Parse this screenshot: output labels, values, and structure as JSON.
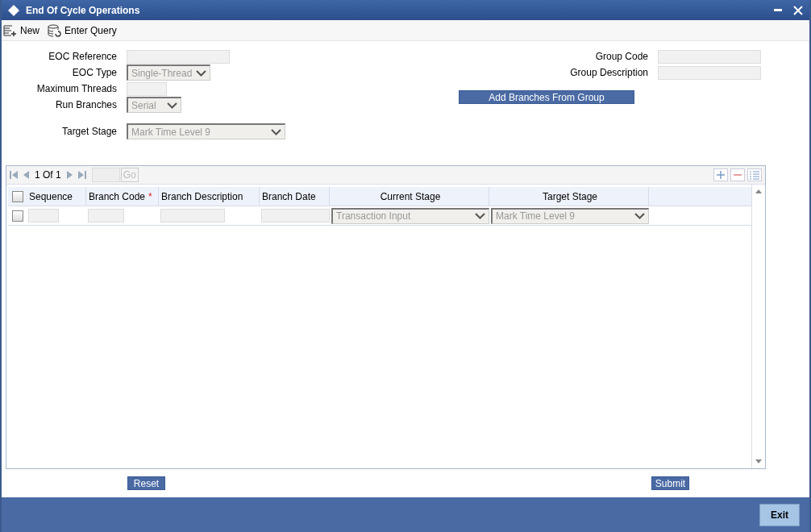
{
  "window": {
    "title": "End Of Cycle Operations"
  },
  "toolbar": [
    {
      "kind": "new",
      "label": "New"
    },
    {
      "kind": "query",
      "label": "Enter Query"
    }
  ],
  "form": {
    "left": [
      {
        "label": "EOC Reference",
        "kind": "text",
        "disabled": true
      },
      {
        "label": "EOC Type",
        "kind": "select",
        "value": "Single-Thread",
        "disabled": true
      },
      {
        "label": "Maximum Threads",
        "kind": "text",
        "disabled": true
      },
      {
        "label": "Run Branches",
        "kind": "select",
        "value": "Serial",
        "disabled": true
      },
      {
        "label": "Target Stage",
        "kind": "select",
        "value": "Mark Time Level 9",
        "disabled": true
      }
    ],
    "right": [
      {
        "label": "Group Code",
        "kind": "text",
        "disabled": true
      },
      {
        "label": "Group Description",
        "kind": "text",
        "disabled": true
      }
    ],
    "action": "Add Branches From Group"
  },
  "grid": {
    "pager": "1 Of 1",
    "go": "Go",
    "select_all": {
      "checked": false
    },
    "columns": [
      {
        "label": "Sequence"
      },
      {
        "label": "Branch Code",
        "marker": "*"
      },
      {
        "label": "Branch Description"
      },
      {
        "label": "Branch Date"
      },
      {
        "label": "Current Stage"
      },
      {
        "label": "Target Stage"
      }
    ],
    "rows": [
      {
        "checked": false,
        "cells": [
          {
            "kind": "text"
          },
          {
            "kind": "text"
          },
          {
            "kind": "text"
          },
          {
            "kind": "text"
          },
          {
            "kind": "select",
            "value": "Transaction Input"
          },
          {
            "kind": "select",
            "value": "Mark Time Level 9"
          }
        ]
      }
    ]
  },
  "buttons": [
    "Reset",
    "Submit"
  ],
  "footer": {
    "exit": "Exit"
  }
}
